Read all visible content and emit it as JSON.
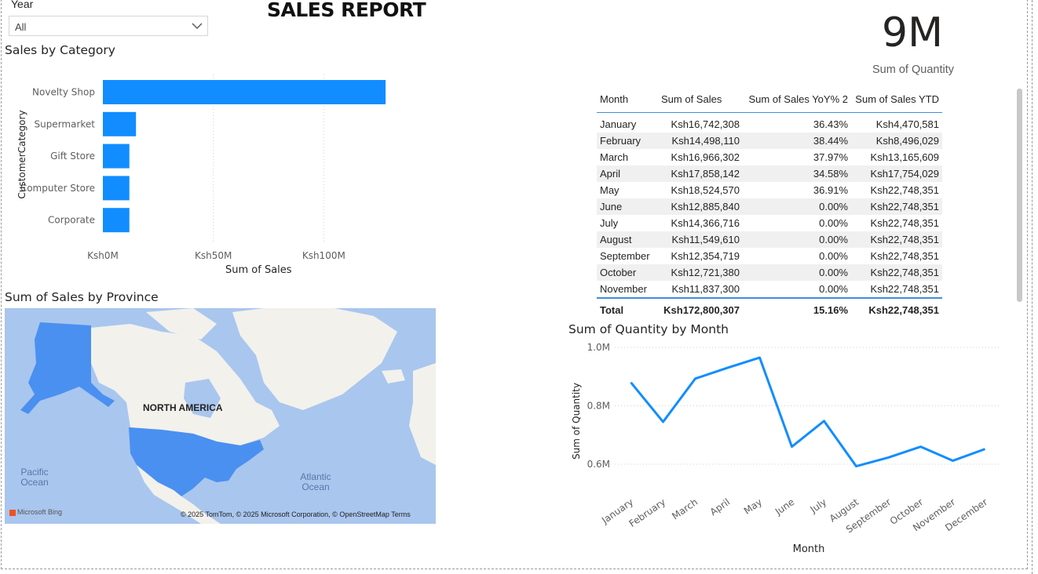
{
  "report_title": "SALES REPORT",
  "slicer": {
    "label": "Year",
    "value": "All"
  },
  "kpi": {
    "value": "9M",
    "label": "Sum of Quantity"
  },
  "category_chart": {
    "title": "Sales by Category",
    "chart_data": {
      "type": "bar",
      "orientation": "horizontal",
      "categories": [
        "Novelty Shop",
        "Supermarket",
        "Gift Store",
        "Computer Store",
        "Corporate"
      ],
      "values": [
        128000000,
        15000000,
        12000000,
        12000000,
        12000000
      ],
      "xlabel": "Sum of Sales",
      "ylabel": "CustomerCategory",
      "xticks": [
        "Ksh0M",
        "Ksh50M",
        "Ksh100M"
      ],
      "xlim": [
        0,
        150000000
      ],
      "color": "#118dff",
      "grid": true
    }
  },
  "sales_table": {
    "columns": [
      "Month",
      "Sum of Sales",
      "Sum of Sales YoY% 2",
      "Sum of Sales YTD"
    ],
    "rows": [
      [
        "January",
        "Ksh16,742,308",
        "36.43%",
        "Ksh4,470,581"
      ],
      [
        "February",
        "Ksh14,498,110",
        "38.44%",
        "Ksh8,496,029"
      ],
      [
        "March",
        "Ksh16,966,302",
        "37.97%",
        "Ksh13,165,609"
      ],
      [
        "April",
        "Ksh17,858,142",
        "34.58%",
        "Ksh17,754,029"
      ],
      [
        "May",
        "Ksh18,524,570",
        "36.91%",
        "Ksh22,748,351"
      ],
      [
        "June",
        "Ksh12,885,840",
        "0.00%",
        "Ksh22,748,351"
      ],
      [
        "July",
        "Ksh14,366,716",
        "0.00%",
        "Ksh22,748,351"
      ],
      [
        "August",
        "Ksh11,549,610",
        "0.00%",
        "Ksh22,748,351"
      ],
      [
        "September",
        "Ksh12,354,719",
        "0.00%",
        "Ksh22,748,351"
      ],
      [
        "October",
        "Ksh12,721,380",
        "0.00%",
        "Ksh22,748,351"
      ],
      [
        "November",
        "Ksh11,837,300",
        "0.00%",
        "Ksh22,748,351"
      ]
    ],
    "total": [
      "Total",
      "Ksh172,800,307",
      "15.16%",
      "Ksh22,748,351"
    ]
  },
  "map_visual": {
    "title": "Sum of Sales by Province",
    "labels": {
      "continent": "NORTH AMERICA",
      "pacific": "Pacific Ocean",
      "atlantic": "Atlantic Ocean"
    },
    "credit": "© 2025 TomTom, © 2025 Microsoft Corporation, © OpenStreetMap  Terms",
    "logo": "Microsoft Bing",
    "colors": {
      "water": "#a9c6ee",
      "land": "#f2f1ec",
      "highlight": "#3a86f0"
    }
  },
  "quantity_chart": {
    "title": "Sum of Quantity by Month",
    "chart_data": {
      "type": "line",
      "x": [
        "January",
        "February",
        "March",
        "April",
        "May",
        "June",
        "July",
        "August",
        "September",
        "October",
        "November",
        "December"
      ],
      "values": [
        880000,
        745000,
        893000,
        930000,
        965000,
        660000,
        748000,
        593000,
        623000,
        660000,
        612000,
        652000
      ],
      "xlabel": "Month",
      "ylabel": "Sum of Quantity",
      "yticks": [
        "0.6M",
        "0.8M",
        "1.0M"
      ],
      "ylim": [
        0.6,
        1.0
      ],
      "y_unit_note": "M",
      "color": "#118dff",
      "grid": true
    }
  }
}
